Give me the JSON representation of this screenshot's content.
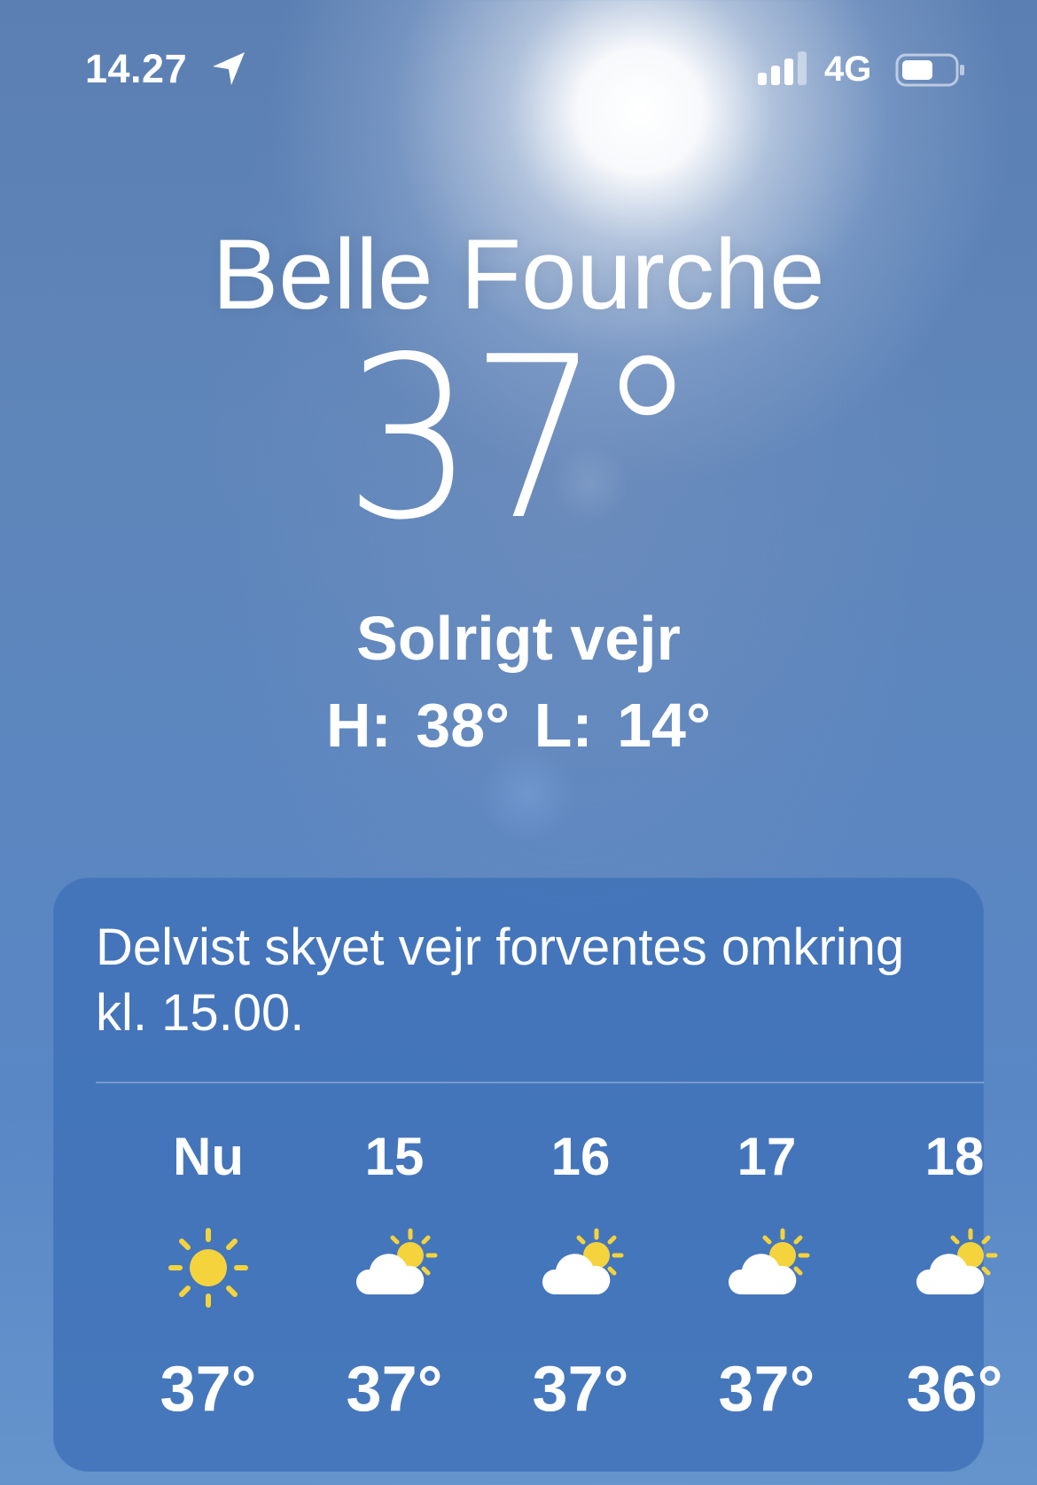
{
  "status_bar": {
    "time": "14.27",
    "network": "4G"
  },
  "weather": {
    "city": "Belle Fourche",
    "temperature": "37°",
    "condition": "Solrigt vejr",
    "high_low": "H: 38°  L: 14°"
  },
  "hourly_card": {
    "summary": "Delvist skyet vejr forventes omkring kl. 15.00.",
    "hours": [
      {
        "label": "Nu",
        "icon": "sun-icon",
        "temp": "37°"
      },
      {
        "label": "15",
        "icon": "partly-cloudy-icon",
        "temp": "37°"
      },
      {
        "label": "16",
        "icon": "partly-cloudy-icon",
        "temp": "37°"
      },
      {
        "label": "17",
        "icon": "partly-cloudy-icon",
        "temp": "37°"
      },
      {
        "label": "18",
        "icon": "partly-cloudy-icon",
        "temp": "36°"
      }
    ]
  },
  "colors": {
    "sun_yellow": "#f5d33c",
    "card_bg": "#3e70b7",
    "sky": "#5b86c0"
  }
}
